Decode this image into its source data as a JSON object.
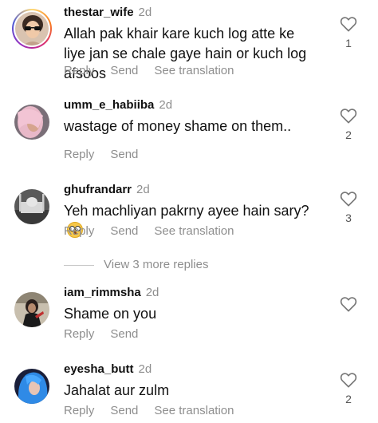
{
  "comments": [
    {
      "username": "thestar_wife",
      "time": "2d",
      "text": "Allah pak khair kare kuch log atte ke liye jan se chale gaye hain or kuch log afsoos",
      "reply": "Reply",
      "send": "Send",
      "translate": "See translation",
      "likes": "1",
      "avatar": "woman-sunglasses"
    },
    {
      "username": "umm_e_habiiba",
      "time": "2d",
      "text": "wastage of money shame on them..",
      "reply": "Reply",
      "send": "Send",
      "likes": "2",
      "avatar": "pink-hair"
    },
    {
      "username": "ghufrandarr",
      "time": "2d",
      "text": "Yeh machliyan pakrny ayee hain sary?",
      "reply": "Reply",
      "send": "Send",
      "translate": "See translation",
      "likes": "3",
      "avatar": "mosque"
    },
    {
      "username": "iam_rimmsha",
      "time": "2d",
      "text": "Shame on you",
      "reply": "Reply",
      "send": "Send",
      "avatar": "person-dark"
    },
    {
      "username": "eyesha_butt",
      "time": "2d",
      "text": "Jahalat aur zulm",
      "reply": "Reply",
      "send": "Send",
      "translate": "See translation",
      "likes": "2",
      "avatar": "blue-hair"
    }
  ],
  "more_replies": "View 3 more replies",
  "emoji": "flushed-face-emoji",
  "colors": {
    "secondary_text": "#8e8e8e",
    "primary_text": "#111111"
  }
}
